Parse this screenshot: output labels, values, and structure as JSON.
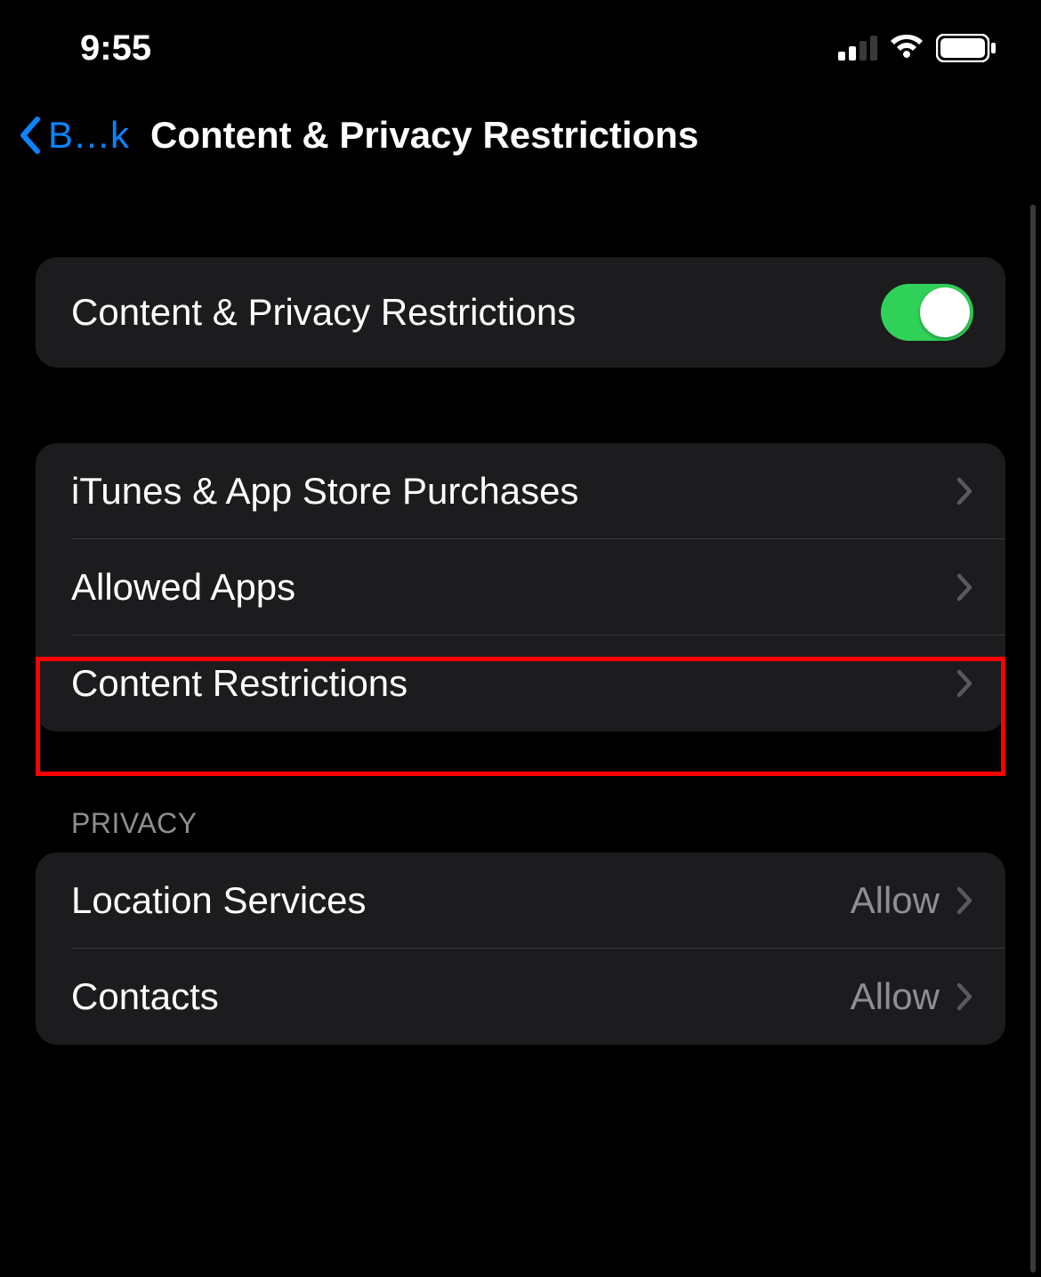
{
  "status": {
    "time": "9:55"
  },
  "nav": {
    "back_label": "B…k",
    "title": "Content & Privacy Restrictions"
  },
  "toggle_section": {
    "label": "Content & Privacy Restrictions",
    "enabled": true
  },
  "content_section": {
    "items": [
      {
        "label": "iTunes & App Store Purchases"
      },
      {
        "label": "Allowed Apps"
      },
      {
        "label": "Content Restrictions"
      }
    ]
  },
  "privacy_section": {
    "header": "PRIVACY",
    "items": [
      {
        "label": "Location Services",
        "value": "Allow"
      },
      {
        "label": "Contacts",
        "value": "Allow"
      }
    ]
  }
}
